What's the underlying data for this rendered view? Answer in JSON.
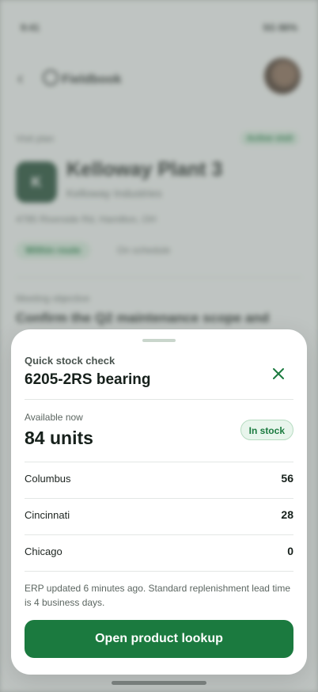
{
  "background": {
    "status_time": "9:41",
    "status_right": "5G 86%",
    "brand": "Fieldbook",
    "section_label": "Visit plan",
    "chip": "Active visit",
    "account_initial": "K",
    "account_name": "Kelloway Plant 3",
    "account_sub": "Kelloway Industries",
    "account_address": "4785 Riverside Rd, Hamilton, OH",
    "pill_green": "Within route",
    "pill_grey": "On schedule",
    "objective_label": "Meeting objective",
    "objective_text": "Confirm the Q2 maintenance scope and"
  },
  "sheet": {
    "eyebrow": "Quick stock check",
    "title": "6205-2RS bearing",
    "available_label": "Available now",
    "available_value": "84 units",
    "status_badge": "In stock",
    "locations": [
      {
        "name": "Columbus",
        "qty": "56"
      },
      {
        "name": "Cincinnati",
        "qty": "28"
      },
      {
        "name": "Chicago",
        "qty": "0"
      }
    ],
    "note": "ERP updated 6 minutes ago. Standard replenishment lead time is 4 business days.",
    "cta_label": "Open product lookup"
  },
  "colors": {
    "accent": "#1b7a3f",
    "badge_bg": "#e8f5ec"
  }
}
